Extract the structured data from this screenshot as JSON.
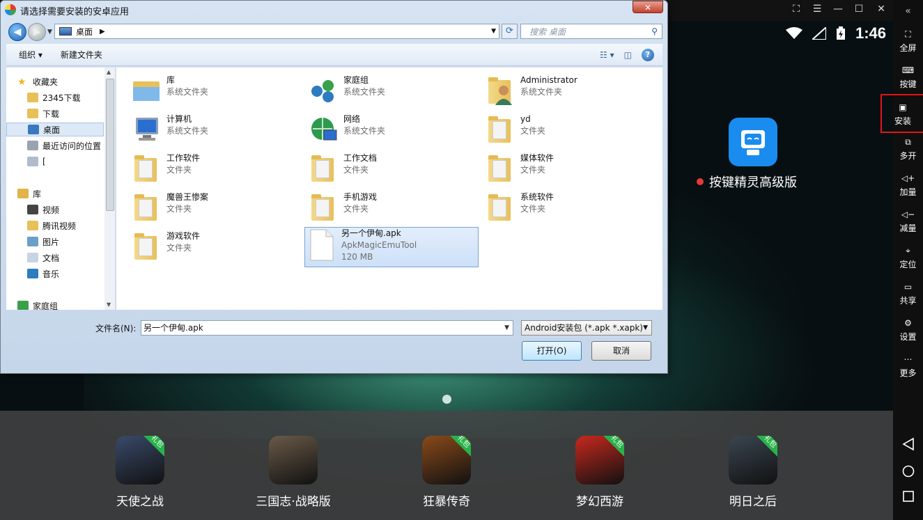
{
  "dialog": {
    "title": "请选择需要安装的安卓应用",
    "address": "桌面",
    "search_placeholder": "搜索 桌面",
    "toolbar": {
      "organize": "组织 ▾",
      "new_folder": "新建文件夹"
    },
    "nav_items": [
      {
        "label": "收藏夹",
        "icon": "star-icon"
      },
      {
        "label": "2345下载",
        "icon": "folder-icon"
      },
      {
        "label": "下载",
        "icon": "download-folder-icon"
      },
      {
        "label": "桌面",
        "icon": "desktop-icon",
        "selected": true
      },
      {
        "label": "最近访问的位置",
        "icon": "recent-places-icon"
      },
      {
        "label": "[",
        "icon": "document-icon"
      },
      {
        "label": "库",
        "icon": "library-icon"
      },
      {
        "label": "视频",
        "icon": "video-icon"
      },
      {
        "label": "腾讯视频",
        "icon": "folder-icon"
      },
      {
        "label": "图片",
        "icon": "pictures-icon"
      },
      {
        "label": "文档",
        "icon": "documents-icon"
      },
      {
        "label": "音乐",
        "icon": "music-icon"
      },
      {
        "label": "家庭组",
        "icon": "homegroup-icon"
      }
    ],
    "files": [
      {
        "name": "库",
        "desc": "系统文件夹",
        "icon": "library-icon"
      },
      {
        "name": "家庭组",
        "desc": "系统文件夹",
        "icon": "homegroup-icon"
      },
      {
        "name": "Administrator",
        "desc": "系统文件夹",
        "icon": "user-folder-icon"
      },
      {
        "name": "计算机",
        "desc": "系统文件夹",
        "icon": "computer-icon"
      },
      {
        "name": "网络",
        "desc": "系统文件夹",
        "icon": "network-icon"
      },
      {
        "name": "yd",
        "desc": "文件夹",
        "icon": "folder-icon"
      },
      {
        "name": "工作软件",
        "desc": "文件夹",
        "icon": "folder-icon"
      },
      {
        "name": "工作文档",
        "desc": "文件夹",
        "icon": "folder-icon"
      },
      {
        "name": "媒体软件",
        "desc": "文件夹",
        "icon": "folder-icon"
      },
      {
        "name": "魔兽王惨案",
        "desc": "文件夹",
        "icon": "folder-icon"
      },
      {
        "name": "手机游戏",
        "desc": "文件夹",
        "icon": "folder-icon"
      },
      {
        "name": "系统软件",
        "desc": "文件夹",
        "icon": "folder-icon"
      },
      {
        "name": "游戏软件",
        "desc": "文件夹",
        "icon": "folder-icon"
      },
      {
        "name": "另一个伊甸.apk",
        "desc": "ApkMagicEmuTool",
        "size": "120 MB",
        "icon": "apk-file-icon",
        "selected": true
      }
    ],
    "filename_label": "文件名(N):",
    "filename_value": "另一个伊甸.apk",
    "filter_value": "Android安装包 (*.apk *.xapk)",
    "open_label": "打开(O)",
    "cancel_label": "取消",
    "close_glyph": "✕"
  },
  "emulator": {
    "clock": "1:46",
    "desktop_app": "按键精灵高级版",
    "dock": [
      {
        "label": "天使之战",
        "badge": "礼包",
        "color": "#3a4a6a"
      },
      {
        "label": "三国志·战略版",
        "badge": "",
        "color": "#6a5a48"
      },
      {
        "label": "狂暴传奇",
        "badge": "礼包",
        "color": "#8a4a1a"
      },
      {
        "label": "梦幻西游",
        "badge": "礼包",
        "color": "#c8281e"
      },
      {
        "label": "明日之后",
        "badge": "礼包",
        "color": "#3a4650"
      }
    ]
  },
  "sidebar": {
    "items": [
      {
        "label": "全屏",
        "icon": "fullscreen-icon"
      },
      {
        "label": "按键",
        "icon": "keyboard-icon"
      },
      {
        "label": "安装",
        "icon": "apk-install-icon",
        "highlighted": true
      },
      {
        "label": "多开",
        "icon": "multi-instance-icon"
      },
      {
        "label": "加量",
        "icon": "volume-up-icon"
      },
      {
        "label": "减量",
        "icon": "volume-down-icon"
      },
      {
        "label": "定位",
        "icon": "location-icon"
      },
      {
        "label": "共享",
        "icon": "shared-folder-icon"
      },
      {
        "label": "设置",
        "icon": "settings-icon"
      },
      {
        "label": "更多",
        "icon": "more-icon"
      }
    ],
    "collapse_glyph": "«"
  }
}
